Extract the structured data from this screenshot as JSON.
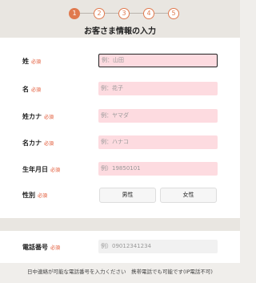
{
  "steps": [
    "1",
    "2",
    "3",
    "4",
    "5"
  ],
  "title": "お客さま情報の入力",
  "required_label": "必須",
  "fields": {
    "last_name": {
      "label": "姓",
      "placeholder": "例：山田"
    },
    "first_name": {
      "label": "名",
      "placeholder": "例：花子"
    },
    "last_name_kana": {
      "label": "姓カナ",
      "placeholder": "例：ヤマダ"
    },
    "first_name_kana": {
      "label": "名カナ",
      "placeholder": "例：ハナコ"
    },
    "birthdate": {
      "label": "生年月日",
      "placeholder": "例）19850101"
    },
    "gender": {
      "label": "性別",
      "options": [
        "男性",
        "女性"
      ]
    },
    "phone": {
      "label": "電話番号",
      "placeholder": "例）09012341234"
    }
  },
  "note": "日中連絡が可能な電話番号を入力ください　携帯電話でも可能です(IP電話不可)",
  "colors": {
    "accent": "#e07a4f",
    "required": "#e0502c",
    "input_bg": "#fddbe0"
  }
}
